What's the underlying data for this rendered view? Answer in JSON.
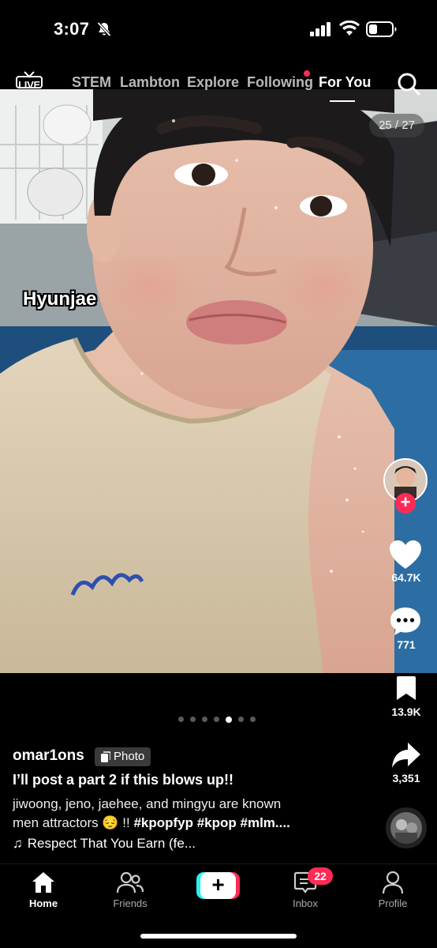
{
  "status": {
    "time": "3:07"
  },
  "top_nav": {
    "live_label": "LIVE",
    "tabs": [
      "STEM",
      "Lambton",
      "Explore",
      "Following",
      "For You"
    ],
    "active_tab": "For You"
  },
  "post": {
    "counter": "25 / 27",
    "overlay_text": "Hyunjae",
    "dots_total": 7,
    "dots_active_index": 4,
    "username": "omar1ons",
    "type_badge": "Photo",
    "title": "I’ll post a part 2 if this blows up!!",
    "description_line1": "jiwoong, jeno, jaehee, and mingyu are known",
    "description_line2_text": "men attractors 😔 !! ",
    "description_hashtags": "#kpopfyp #kpop #mlm....",
    "sound": "Respect That You Earn (fe..."
  },
  "actions": {
    "likes": "64.7K",
    "comments": "771",
    "saves": "13.9K",
    "shares": "3,351"
  },
  "bottom_nav": {
    "home": "Home",
    "friends": "Friends",
    "create": "+",
    "inbox": "Inbox",
    "inbox_badge": "22",
    "profile": "Profile"
  },
  "colors": {
    "accent": "#fe2c55",
    "cyan": "#25f4ee"
  }
}
